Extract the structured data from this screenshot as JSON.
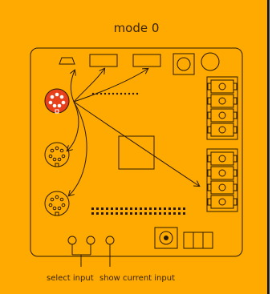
{
  "title": "mode 0",
  "labels": {
    "select_input": "select input",
    "show_current_input": "show current input"
  },
  "colors": {
    "background": "#ffaa00",
    "ink": "#2a1a00",
    "active_connector": "#e8401a"
  },
  "inputs": [
    {
      "name": "input-1",
      "active": true
    },
    {
      "name": "input-2",
      "active": false
    },
    {
      "name": "input-3",
      "active": false
    }
  ]
}
